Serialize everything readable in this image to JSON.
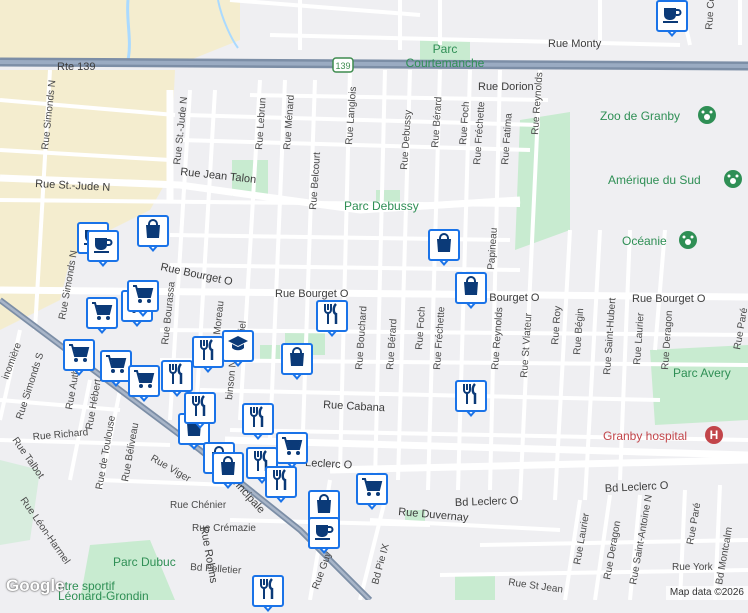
{
  "map": {
    "attribution": "Map data ©2026",
    "logo": "Google",
    "highway_label": "Rte 139",
    "route_shield": "139"
  },
  "streets": {
    "rte139": "Rte 139",
    "monty": "Rue Monty",
    "dorion": "Rue Dorion",
    "st_jude_n": "Rue St.-Jude N",
    "jean_talon": "Rue Jean Talon",
    "bourget_o_left": "Rue Bourget O",
    "bourget_o_mid": "Rue Bourget O",
    "bourget_o_right": "Rue Bourget O",
    "bourget_o_far": "Rue Bourget O",
    "bourget_o_c": "Rue Bourget O",
    "cabana": "Rue Cabana",
    "leclerc_o_left": "Leclerc O",
    "leclerc_o_mid": "Bd Leclerc O",
    "leclerc_o_right": "Bd Leclerc O",
    "principale": "Principale",
    "duvernay": "Rue Duvernay",
    "chenier": "Rue Chénier",
    "cremazie": "Rue Crémazie",
    "pelletier": "Bd Pelletier",
    "st_jean": "Rue St Jean",
    "york": "Rue York",
    "simonds_n": "Rue Simonds N",
    "simonds_s": "Rue Simonds S",
    "st_jude_n_vert": "Rue St.-Jude N",
    "lebrun": "Rue Lebrun",
    "menard": "Rue Ménard",
    "belcourt": "Rue Belcourt",
    "langlois": "Rue Langlois",
    "debussy": "Rue Debussy",
    "berard_top": "Rue Bérard",
    "foch_top": "Rue Foch",
    "frechette_top": "Rue Fréchette",
    "fatima": "Rue Fatima",
    "reynolds_top": "Rue Reynolds",
    "papineau": "Papineau",
    "bouchard": "Rue Bouchard",
    "berard_mid": "Rue Bérard",
    "foch_mid": "Rue Foch",
    "frechette_mid": "Rue Fréchette",
    "reynolds_mid": "Rue Reynolds",
    "st_viateur": "Rue St Viateur",
    "roy": "Rue Roy",
    "begin": "Rue Bégin",
    "saint_hubert": "Rue Saint-Hubert",
    "laurier_top": "Rue Laurier",
    "deragon_top": "Rue Deragon",
    "bourassa": "Rue Bourassa",
    "moreau": "Moreau",
    "gabriel": "briel",
    "robinson": "binson N",
    "robinson_s": "Rue Robins",
    "authier": "Rue Authier",
    "hebert": "Rue Hébert",
    "de_toulouse": "Rue de Toulouse",
    "beliveau": "Rue Béliveau",
    "viger": "Rue Viger",
    "richard": "Rue Richard",
    "talbot": "Rue Talbot",
    "leon_harmel": "Rue Léon-Harmel",
    "laurier_bot": "Rue Laurier",
    "deragon_bot": "Rue Deragon",
    "saint_antoine": "Rue Saint-Antoine N",
    "pare": "Rue Paré",
    "montcalm": "Bd Montcalm",
    "pie_ix": "Bd Pie IX",
    "guy": "Rue Guy",
    "conrad": "Rue Conrad",
    "lanomiere": "inomière",
    "harmel_bot": "Harmel",
    "rue_bot": "Rue",
    "ard": "ard",
    "rue_top1": "s",
    "rue_top2": "Rue",
    "rue_top3": "Rue",
    "rue_top4": "Rue",
    "rue_right1": "Rue Paré",
    "rue_ang": "ang"
  },
  "places": {
    "parc_courtemanche_1": "Parc",
    "parc_courtemanche_2": "Courtemanche",
    "zoo": "Zoo de Granby",
    "amerique": "Amérique du Sud",
    "parc_debussy": "Parc Debussy",
    "oceanie": "Océanie",
    "parc_avery": "Parc Avery",
    "hospital": "Granby hospital",
    "parc_dubuc": "Parc Dubuc",
    "centre_sportif": "ntre sportif",
    "leonard_grondin": "Léonard-Grondin",
    "an": "An"
  },
  "colors": {
    "poi_blue": "#1a73e8",
    "park_green": "#c8ebd0",
    "park_text": "#2f8f55",
    "hospital_red": "#c2454a",
    "highway": "#7c8ea6",
    "urban": "#f4edcf"
  },
  "pois": [
    {
      "icon": "cafe-icon",
      "type": "cafe"
    },
    {
      "icon": "shopping-bag-icon",
      "type": "store"
    },
    {
      "icon": "cafe-icon",
      "type": "cafe"
    },
    {
      "icon": "cafe-icon",
      "type": "cafe"
    },
    {
      "icon": "shopping-bag-icon",
      "type": "store"
    },
    {
      "icon": "shopping-cart-icon",
      "type": "supermarket"
    },
    {
      "icon": "shopping-cart-icon",
      "type": "supermarket"
    },
    {
      "icon": "shopping-cart-icon",
      "type": "supermarket"
    },
    {
      "icon": "shopping-bag-icon",
      "type": "store"
    },
    {
      "icon": "restaurant-icon",
      "type": "restaurant"
    },
    {
      "icon": "shopping-bag-icon",
      "type": "store"
    },
    {
      "icon": "shopping-cart-icon",
      "type": "supermarket"
    },
    {
      "icon": "shopping-cart-icon",
      "type": "supermarket"
    },
    {
      "icon": "shopping-cart-icon",
      "type": "supermarket"
    },
    {
      "icon": "restaurant-icon",
      "type": "restaurant"
    },
    {
      "icon": "restaurant-icon",
      "type": "restaurant"
    },
    {
      "icon": "shopping-bag-icon",
      "type": "store"
    },
    {
      "icon": "restaurant-icon",
      "type": "restaurant"
    },
    {
      "icon": "restaurant-icon",
      "type": "restaurant"
    },
    {
      "icon": "shopping-bag-icon",
      "type": "store"
    },
    {
      "icon": "restaurant-icon",
      "type": "restaurant"
    },
    {
      "icon": "shopping-bag-icon",
      "type": "store"
    },
    {
      "icon": "shopping-cart-icon",
      "type": "supermarket"
    },
    {
      "icon": "restaurant-icon",
      "type": "restaurant"
    },
    {
      "icon": "restaurant-icon",
      "type": "restaurant"
    },
    {
      "icon": "shopping-bag-icon",
      "type": "store"
    },
    {
      "icon": "shopping-cart-icon",
      "type": "supermarket"
    },
    {
      "icon": "cafe-icon",
      "type": "cafe"
    },
    {
      "icon": "restaurant-icon",
      "type": "restaurant"
    },
    {
      "icon": "school-icon",
      "type": "school"
    }
  ]
}
